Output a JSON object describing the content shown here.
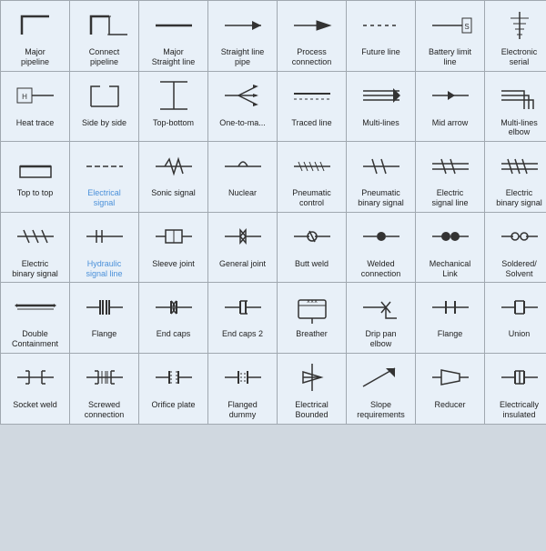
{
  "cells": [
    {
      "id": "major-pipeline",
      "label": "Major\npipeline"
    },
    {
      "id": "connect-pipeline",
      "label": "Connect\npipeline"
    },
    {
      "id": "major-straight-line",
      "label": "Major\nStraight line"
    },
    {
      "id": "straight-line-pipe",
      "label": "Straight line\npipe"
    },
    {
      "id": "process-connection",
      "label": "Process\nconnection"
    },
    {
      "id": "future-line",
      "label": "Future line"
    },
    {
      "id": "battery-limit-line",
      "label": "Battery limit\nline"
    },
    {
      "id": "electronic-serial",
      "label": "Electronic\nserial"
    },
    {
      "id": "heat-trace",
      "label": "Heat trace"
    },
    {
      "id": "side-by-side",
      "label": "Side by side"
    },
    {
      "id": "top-bottom",
      "label": "Top-bottom"
    },
    {
      "id": "one-to-many",
      "label": "One-to-ma..."
    },
    {
      "id": "traced-line",
      "label": "Traced line"
    },
    {
      "id": "multi-lines",
      "label": "Multi-lines"
    },
    {
      "id": "mid-arrow",
      "label": "Mid arrow"
    },
    {
      "id": "multi-lines-elbow",
      "label": "Multi-lines\nelbow"
    },
    {
      "id": "top-to-top",
      "label": "Top to top"
    },
    {
      "id": "electrical-signal",
      "label": "Electrical\nsignal"
    },
    {
      "id": "sonic-signal",
      "label": "Sonic signal"
    },
    {
      "id": "nuclear",
      "label": "Nuclear"
    },
    {
      "id": "pneumatic-control",
      "label": "Pneumatic\ncontrol"
    },
    {
      "id": "pneumatic-binary-signal",
      "label": "Pneumatic\nbinary signal"
    },
    {
      "id": "electric-signal-line",
      "label": "Electric\nsignal line"
    },
    {
      "id": "electric-binary-signal",
      "label": "Electric\nbinary signal"
    },
    {
      "id": "electric-binary-signal2",
      "label": "Electric\nbinary signal"
    },
    {
      "id": "hydraulic-signal-line",
      "label": "Hydraulic\nsignal line"
    },
    {
      "id": "sleeve-joint",
      "label": "Sleeve joint"
    },
    {
      "id": "general-joint",
      "label": "General joint"
    },
    {
      "id": "butt-weld",
      "label": "Butt weld"
    },
    {
      "id": "welded-connection",
      "label": "Welded\nconnection"
    },
    {
      "id": "mechanical-link",
      "label": "Mechanical\nLink"
    },
    {
      "id": "soldered-solvent",
      "label": "Soldered/\nSolvent"
    },
    {
      "id": "double-containment",
      "label": "Double\nContainment"
    },
    {
      "id": "flange",
      "label": "Flange"
    },
    {
      "id": "end-caps",
      "label": "End caps"
    },
    {
      "id": "end-caps-2",
      "label": "End caps 2"
    },
    {
      "id": "breather",
      "label": "Breather"
    },
    {
      "id": "drip-pan-elbow",
      "label": "Drip pan\nelbow"
    },
    {
      "id": "flange2",
      "label": "Flange"
    },
    {
      "id": "union",
      "label": "Union"
    },
    {
      "id": "socket-weld",
      "label": "Socket weld"
    },
    {
      "id": "screwed-connection",
      "label": "Screwed\nconnection"
    },
    {
      "id": "orifice-plate",
      "label": "Orifice plate"
    },
    {
      "id": "flanged-dummy",
      "label": "Flanged\ndummy"
    },
    {
      "id": "electrical-bounded",
      "label": "Electrical\nBounded"
    },
    {
      "id": "slope-requirements",
      "label": "Slope\nrequirements"
    },
    {
      "id": "reducer",
      "label": "Reducer"
    },
    {
      "id": "electrically-insulated",
      "label": "Electrically\ninsulated"
    }
  ]
}
